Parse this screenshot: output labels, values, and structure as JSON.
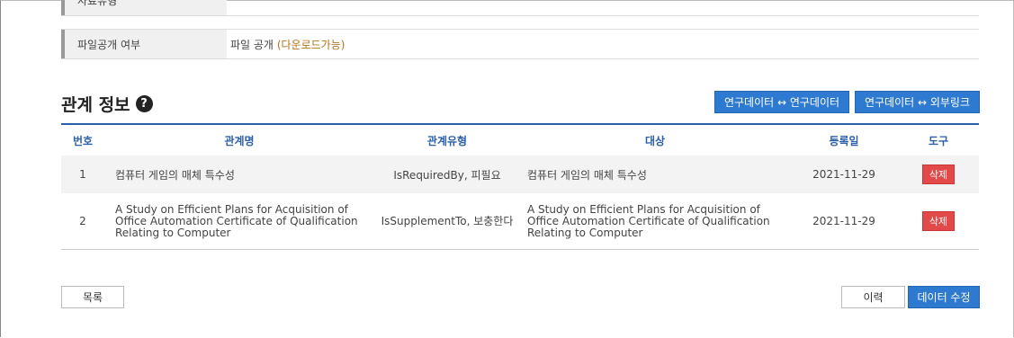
{
  "info": {
    "cut_label": "자료유형",
    "file_label": "파일공개 여부",
    "file_value": "파일 공개",
    "file_value_note": "(다운로드가능)"
  },
  "relation": {
    "title": "관계 정보",
    "help_glyph": "?",
    "btn_data_data": "연구데이터 ↔ 연구데이터",
    "btn_data_link": "연구데이터 ↔ 외부링크",
    "headers": [
      "번호",
      "관계명",
      "관계유형",
      "대상",
      "등록일",
      "도구"
    ],
    "rows": [
      {
        "no": "1",
        "name": "컴퓨터 게임의 매체 특수성",
        "type": "IsRequiredBy, 피필요",
        "target": "컴퓨터 게임의 매체 특수성",
        "date": "2021-11-29",
        "tool": "삭제"
      },
      {
        "no": "2",
        "name": "A Study on Efficient Plans for Acquisition of Office Automation Certificate of Qualification Relating to Computer",
        "type": "IsSupplementTo, 보충한다",
        "target": "A Study on Efficient Plans for Acquisition of Office Automation Certificate of Qualification Relating to Computer",
        "date": "2021-11-29",
        "tool": "삭제"
      }
    ]
  },
  "footer": {
    "list_label": "목록",
    "history_label": "이력",
    "edit_label": "데이터 수정"
  },
  "colors": {
    "accent_blue": "#2f7ad1",
    "header_blue": "#2b5fa8",
    "delete_red": "#e24a4a",
    "file_note": "#b5731a"
  }
}
